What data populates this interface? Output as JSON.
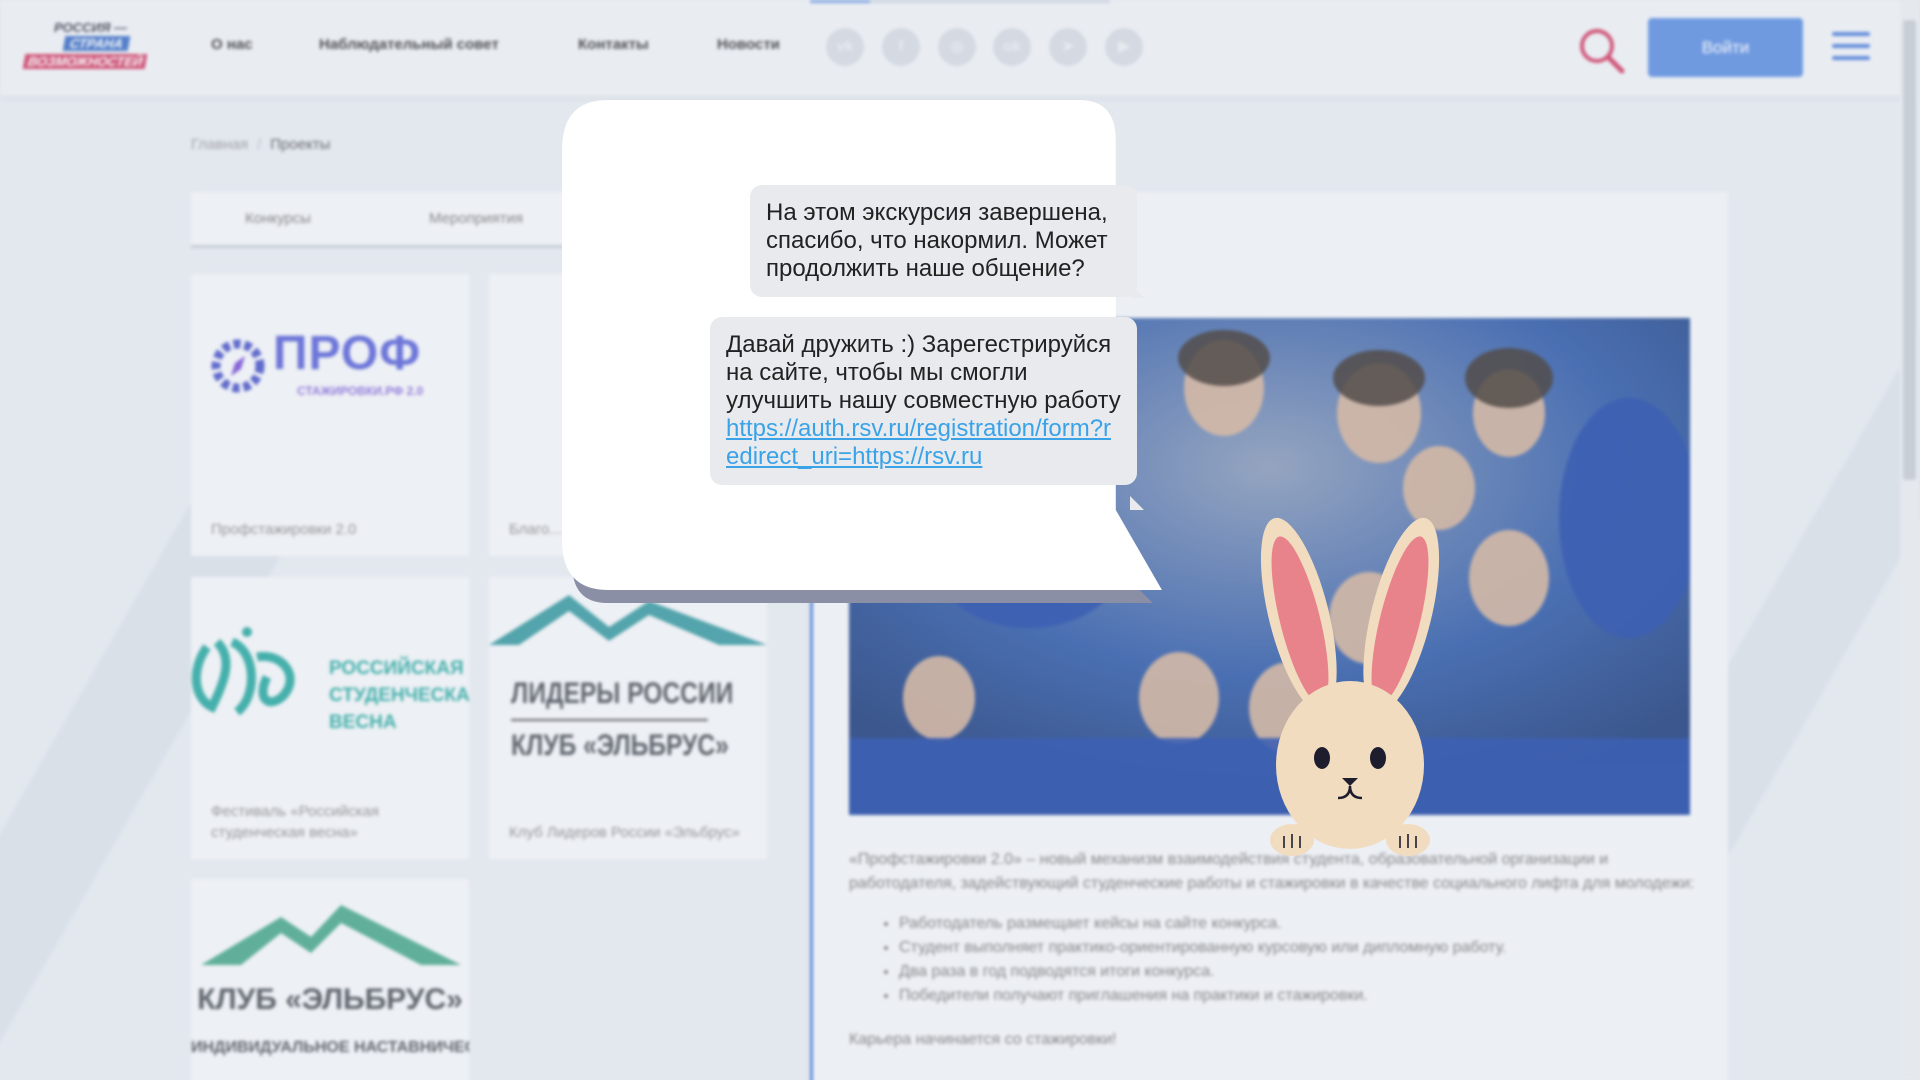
{
  "header": {
    "logo": {
      "line1": "РОССИЯ —",
      "line2": "СТРАНА",
      "line3": "ВОЗМОЖНОСТЕЙ"
    },
    "nav": [
      "О нас",
      "Наблюдательный совет",
      "Контакты",
      "Новости"
    ],
    "social_icons": [
      "vk-icon",
      "facebook-icon",
      "instagram-icon",
      "ok-icon",
      "telegram-icon",
      "youtube-icon"
    ],
    "social_glyphs": [
      "vk",
      "f",
      "◎",
      "ok",
      "➤",
      "▶"
    ],
    "login_label": "Войти"
  },
  "breadcrumb": {
    "home": "Главная",
    "separator": "/",
    "current": "Проекты"
  },
  "tabs": [
    "Конкурсы",
    "Мероприятия"
  ],
  "cards": [
    {
      "logo_main": "ПРОФ",
      "logo_sub": "СТАЖИРОВКИ.РФ 2.0",
      "title": "Профстажировки 2.0"
    },
    {
      "title": "Благо... «Мечта..."
    },
    {
      "logo_lines": [
        "РОССИЙСКАЯ",
        "СТУДЕНЧЕСКАЯ",
        "ВЕСНА"
      ],
      "title": "Фестиваль «Российская студенческая весна»"
    },
    {
      "logo_lines": [
        "ЛИДЕРЫ РОССИИ",
        "КЛУБ «ЭЛЬБРУС»"
      ],
      "title": "Клуб Лидеров России «Эльбрус»"
    },
    {
      "logo_lines": [
        "КЛУБ «ЭЛЬБРУС»",
        "ИНДИВИДУАЛЬНОЕ НАСТАВНИЧЕСТВО"
      ]
    }
  ],
  "detail": {
    "description": "«Профстажировки 2.0» – новый механизм взаимодействия студента, образовательной организации и работодателя, задействующий студенческие работы и стажировки в качестве социального лифта для молодежи:",
    "bullets": [
      "Работодатель размещает кейсы на сайте конкурса.",
      "Студент выполняет практико-ориентированную курсовую или дипломную работу.",
      "Два раза в год подводятся итоги конкурса.",
      "Победители получают приглашения на практики и стажировки."
    ],
    "career": "Карьера начинается со стажировки!"
  },
  "dialog": {
    "message1": "На этом экскурсия завершена, спасибо, что накормил. Может продолжить наше общение?",
    "message2_text": "Давай дружить :) Зарегестрируйся на сайте, чтобы мы смогли улучшить нашу совместную работу",
    "message2_link": "https://auth.rsv.ru/registration/form?redirect_uri=https://rsv.ru"
  },
  "colors": {
    "accent": "#4b7dd9",
    "login_button": "#5d8ee0",
    "search_icon": "#d23c62",
    "link": "#3aa3e8",
    "bubble_shadow": "#8a8fa6",
    "bunny_ear": "#e8838c",
    "bunny_body": "#f2dcc0"
  }
}
